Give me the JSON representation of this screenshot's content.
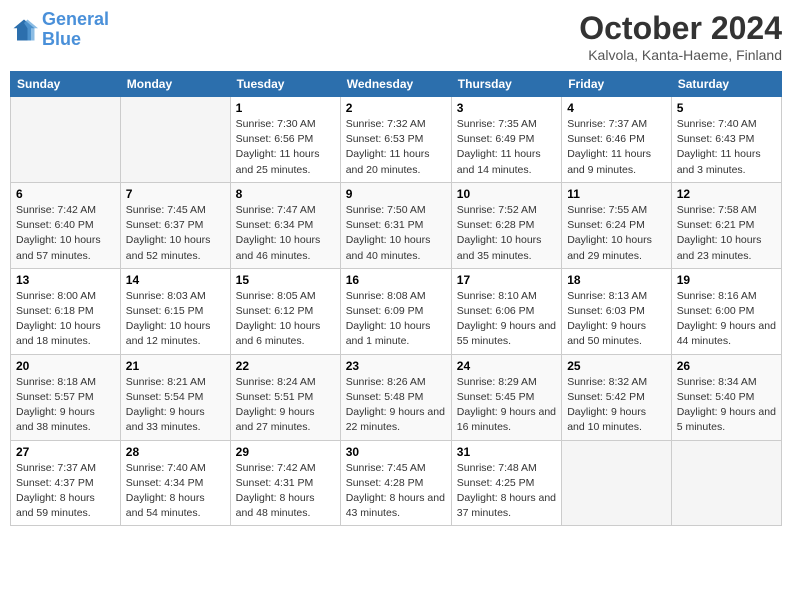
{
  "logo": {
    "line1": "General",
    "line2": "Blue"
  },
  "title": "October 2024",
  "subtitle": "Kalvola, Kanta-Haeme, Finland",
  "days_header": [
    "Sunday",
    "Monday",
    "Tuesday",
    "Wednesday",
    "Thursday",
    "Friday",
    "Saturday"
  ],
  "weeks": [
    [
      {
        "num": "",
        "sunrise": "",
        "sunset": "",
        "daylight": ""
      },
      {
        "num": "",
        "sunrise": "",
        "sunset": "",
        "daylight": ""
      },
      {
        "num": "1",
        "sunrise": "Sunrise: 7:30 AM",
        "sunset": "Sunset: 6:56 PM",
        "daylight": "Daylight: 11 hours and 25 minutes."
      },
      {
        "num": "2",
        "sunrise": "Sunrise: 7:32 AM",
        "sunset": "Sunset: 6:53 PM",
        "daylight": "Daylight: 11 hours and 20 minutes."
      },
      {
        "num": "3",
        "sunrise": "Sunrise: 7:35 AM",
        "sunset": "Sunset: 6:49 PM",
        "daylight": "Daylight: 11 hours and 14 minutes."
      },
      {
        "num": "4",
        "sunrise": "Sunrise: 7:37 AM",
        "sunset": "Sunset: 6:46 PM",
        "daylight": "Daylight: 11 hours and 9 minutes."
      },
      {
        "num": "5",
        "sunrise": "Sunrise: 7:40 AM",
        "sunset": "Sunset: 6:43 PM",
        "daylight": "Daylight: 11 hours and 3 minutes."
      }
    ],
    [
      {
        "num": "6",
        "sunrise": "Sunrise: 7:42 AM",
        "sunset": "Sunset: 6:40 PM",
        "daylight": "Daylight: 10 hours and 57 minutes."
      },
      {
        "num": "7",
        "sunrise": "Sunrise: 7:45 AM",
        "sunset": "Sunset: 6:37 PM",
        "daylight": "Daylight: 10 hours and 52 minutes."
      },
      {
        "num": "8",
        "sunrise": "Sunrise: 7:47 AM",
        "sunset": "Sunset: 6:34 PM",
        "daylight": "Daylight: 10 hours and 46 minutes."
      },
      {
        "num": "9",
        "sunrise": "Sunrise: 7:50 AM",
        "sunset": "Sunset: 6:31 PM",
        "daylight": "Daylight: 10 hours and 40 minutes."
      },
      {
        "num": "10",
        "sunrise": "Sunrise: 7:52 AM",
        "sunset": "Sunset: 6:28 PM",
        "daylight": "Daylight: 10 hours and 35 minutes."
      },
      {
        "num": "11",
        "sunrise": "Sunrise: 7:55 AM",
        "sunset": "Sunset: 6:24 PM",
        "daylight": "Daylight: 10 hours and 29 minutes."
      },
      {
        "num": "12",
        "sunrise": "Sunrise: 7:58 AM",
        "sunset": "Sunset: 6:21 PM",
        "daylight": "Daylight: 10 hours and 23 minutes."
      }
    ],
    [
      {
        "num": "13",
        "sunrise": "Sunrise: 8:00 AM",
        "sunset": "Sunset: 6:18 PM",
        "daylight": "Daylight: 10 hours and 18 minutes."
      },
      {
        "num": "14",
        "sunrise": "Sunrise: 8:03 AM",
        "sunset": "Sunset: 6:15 PM",
        "daylight": "Daylight: 10 hours and 12 minutes."
      },
      {
        "num": "15",
        "sunrise": "Sunrise: 8:05 AM",
        "sunset": "Sunset: 6:12 PM",
        "daylight": "Daylight: 10 hours and 6 minutes."
      },
      {
        "num": "16",
        "sunrise": "Sunrise: 8:08 AM",
        "sunset": "Sunset: 6:09 PM",
        "daylight": "Daylight: 10 hours and 1 minute."
      },
      {
        "num": "17",
        "sunrise": "Sunrise: 8:10 AM",
        "sunset": "Sunset: 6:06 PM",
        "daylight": "Daylight: 9 hours and 55 minutes."
      },
      {
        "num": "18",
        "sunrise": "Sunrise: 8:13 AM",
        "sunset": "Sunset: 6:03 PM",
        "daylight": "Daylight: 9 hours and 50 minutes."
      },
      {
        "num": "19",
        "sunrise": "Sunrise: 8:16 AM",
        "sunset": "Sunset: 6:00 PM",
        "daylight": "Daylight: 9 hours and 44 minutes."
      }
    ],
    [
      {
        "num": "20",
        "sunrise": "Sunrise: 8:18 AM",
        "sunset": "Sunset: 5:57 PM",
        "daylight": "Daylight: 9 hours and 38 minutes."
      },
      {
        "num": "21",
        "sunrise": "Sunrise: 8:21 AM",
        "sunset": "Sunset: 5:54 PM",
        "daylight": "Daylight: 9 hours and 33 minutes."
      },
      {
        "num": "22",
        "sunrise": "Sunrise: 8:24 AM",
        "sunset": "Sunset: 5:51 PM",
        "daylight": "Daylight: 9 hours and 27 minutes."
      },
      {
        "num": "23",
        "sunrise": "Sunrise: 8:26 AM",
        "sunset": "Sunset: 5:48 PM",
        "daylight": "Daylight: 9 hours and 22 minutes."
      },
      {
        "num": "24",
        "sunrise": "Sunrise: 8:29 AM",
        "sunset": "Sunset: 5:45 PM",
        "daylight": "Daylight: 9 hours and 16 minutes."
      },
      {
        "num": "25",
        "sunrise": "Sunrise: 8:32 AM",
        "sunset": "Sunset: 5:42 PM",
        "daylight": "Daylight: 9 hours and 10 minutes."
      },
      {
        "num": "26",
        "sunrise": "Sunrise: 8:34 AM",
        "sunset": "Sunset: 5:40 PM",
        "daylight": "Daylight: 9 hours and 5 minutes."
      }
    ],
    [
      {
        "num": "27",
        "sunrise": "Sunrise: 7:37 AM",
        "sunset": "Sunset: 4:37 PM",
        "daylight": "Daylight: 8 hours and 59 minutes."
      },
      {
        "num": "28",
        "sunrise": "Sunrise: 7:40 AM",
        "sunset": "Sunset: 4:34 PM",
        "daylight": "Daylight: 8 hours and 54 minutes."
      },
      {
        "num": "29",
        "sunrise": "Sunrise: 7:42 AM",
        "sunset": "Sunset: 4:31 PM",
        "daylight": "Daylight: 8 hours and 48 minutes."
      },
      {
        "num": "30",
        "sunrise": "Sunrise: 7:45 AM",
        "sunset": "Sunset: 4:28 PM",
        "daylight": "Daylight: 8 hours and 43 minutes."
      },
      {
        "num": "31",
        "sunrise": "Sunrise: 7:48 AM",
        "sunset": "Sunset: 4:25 PM",
        "daylight": "Daylight: 8 hours and 37 minutes."
      },
      {
        "num": "",
        "sunrise": "",
        "sunset": "",
        "daylight": ""
      },
      {
        "num": "",
        "sunrise": "",
        "sunset": "",
        "daylight": ""
      }
    ]
  ]
}
